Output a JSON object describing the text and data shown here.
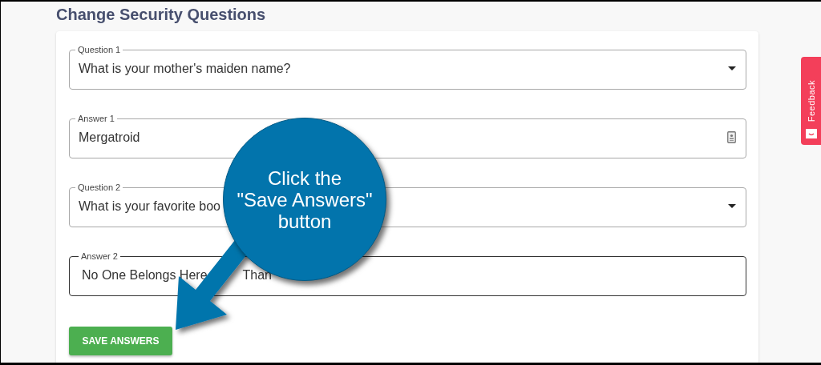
{
  "title": "Change Security Questions",
  "fields": [
    {
      "kind": "select",
      "label": "Question 1",
      "value": "What is your mother's maiden name?",
      "focused": false
    },
    {
      "kind": "secret",
      "label": "Answer 1",
      "value": "Mergatroid",
      "focused": false
    },
    {
      "kind": "select",
      "label": "Question 2",
      "value": "What is your favorite boo",
      "focused": false
    },
    {
      "kind": "text",
      "label": "Answer 2",
      "value_parts": [
        "No One Belongs Here",
        "Than"
      ],
      "focused": true
    }
  ],
  "button": "SAVE ANSWERS",
  "callout_lines": [
    "Click the",
    "\"Save Answers\"",
    "button"
  ],
  "feedback": "Feedback"
}
